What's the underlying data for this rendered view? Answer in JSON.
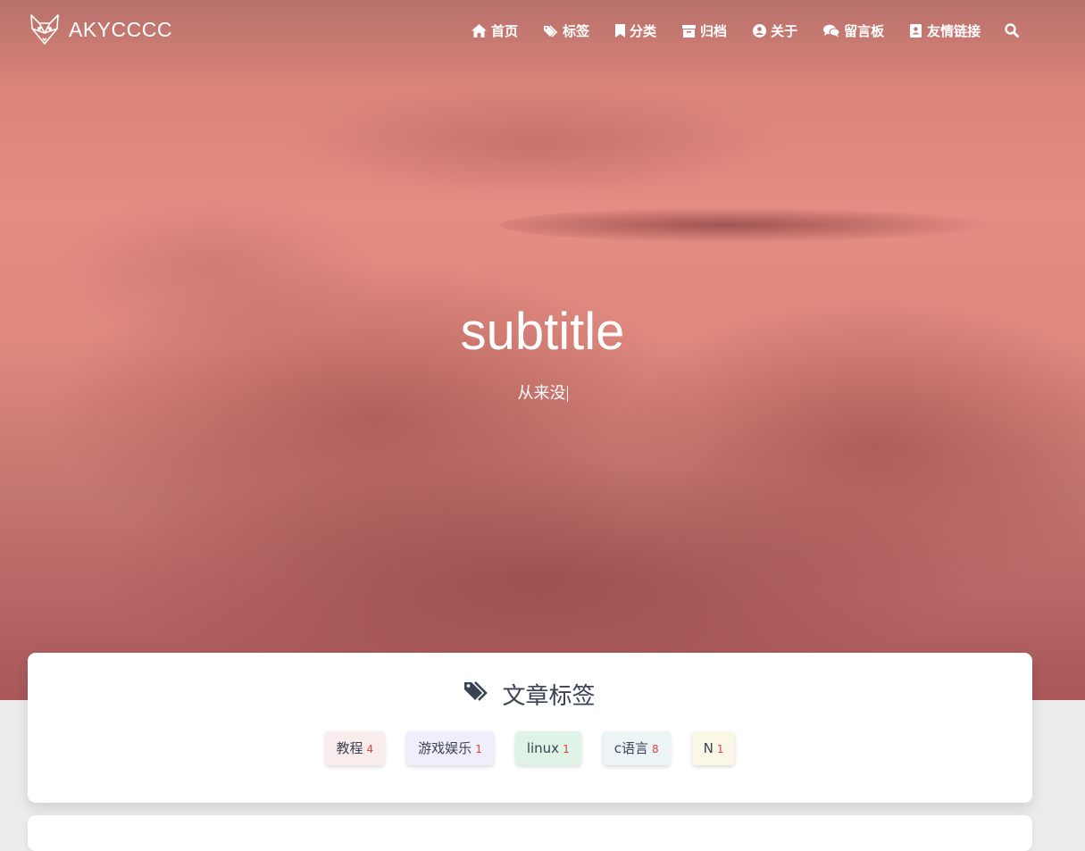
{
  "brand": {
    "name": "AKYCCCC",
    "logo_icon": "fox-icon"
  },
  "nav": {
    "items": [
      {
        "label": "首页",
        "icon": "home-icon"
      },
      {
        "label": "标签",
        "icon": "tags-icon"
      },
      {
        "label": "分类",
        "icon": "bookmark-icon"
      },
      {
        "label": "归档",
        "icon": "archive-icon"
      },
      {
        "label": "关于",
        "icon": "user-circle-icon"
      },
      {
        "label": "留言板",
        "icon": "comments-icon"
      },
      {
        "label": "友情链接",
        "icon": "address-book-icon"
      }
    ],
    "search_icon": "search-icon"
  },
  "hero": {
    "title": "subtitle",
    "subtitle": "从来没"
  },
  "tags_card": {
    "title": "文章标签",
    "icon": "tags-icon",
    "tags": [
      {
        "name": "教程",
        "count": "4",
        "bg": "#f9ecec"
      },
      {
        "name": "游戏娱乐",
        "count": "1",
        "bg": "#f1eefb"
      },
      {
        "name": "linux",
        "count": "1",
        "bg": "#dff3e7"
      },
      {
        "name": "c语言",
        "count": "8",
        "bg": "#ecf4f6"
      },
      {
        "name": "N",
        "count": "1",
        "bg": "#fbf7e6"
      }
    ]
  },
  "colors": {
    "hero_tone": "#e48d83",
    "text_dark": "#3a4253",
    "tag_count": "#e2403b"
  }
}
